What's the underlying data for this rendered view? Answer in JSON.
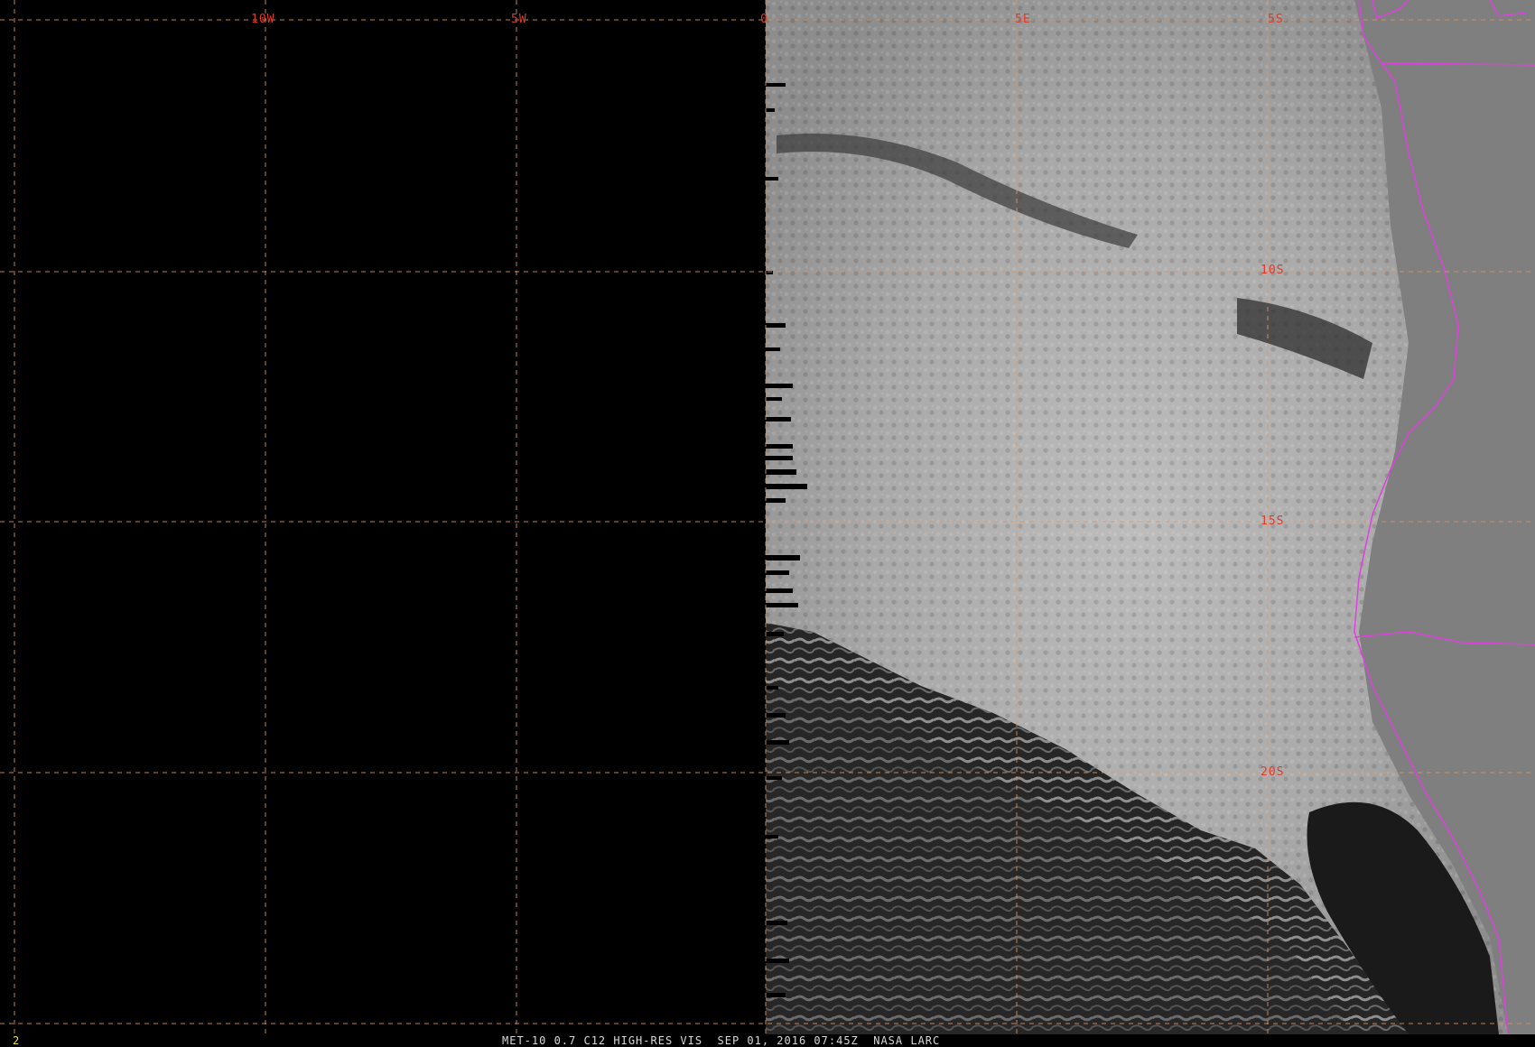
{
  "image": {
    "title": "MET-10 0.7 C12 HIGH-RES VIS  SEP 01, 2016 07:45Z  NASA LARC",
    "frame": "2"
  },
  "grid": {
    "longitude_labels": [
      "10W",
      "5W",
      "0",
      "5E"
    ],
    "latitude_labels": [
      "5S",
      "10S",
      "15S",
      "20S"
    ]
  },
  "colors": {
    "grid": "#d89a6a",
    "grid_label": "#e03a2a",
    "coastline": "#e040e0",
    "status_text": "#d8d8d8",
    "frame_number": "#f0e040"
  },
  "features": [
    "cloud-cover-region",
    "coastline-boundary",
    "no-data-region"
  ]
}
